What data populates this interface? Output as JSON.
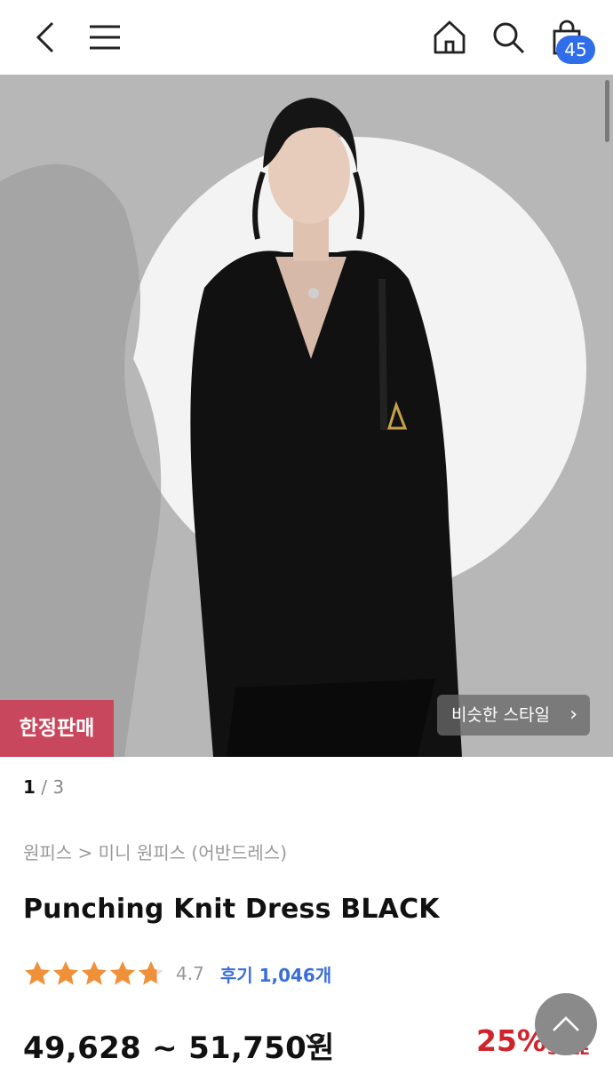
{
  "header": {
    "back_icon": "chevron-left-icon",
    "menu_icon": "hamburger-menu-icon",
    "home_icon": "home-icon",
    "search_icon": "search-icon",
    "cart_icon": "shopping-bag-icon",
    "cart_count": "45"
  },
  "hero": {
    "limited_label": "한정판매",
    "similar_style_label": "비슷한 스타일",
    "colors": {
      "badge": "#c9475c",
      "backdrop": "#b9b9b9"
    }
  },
  "gallery": {
    "current": "1",
    "separator": " / ",
    "total": "3"
  },
  "product": {
    "breadcrumb": "원피스 > 미니 원피스 (어반드레스)",
    "title": "Punching Knit Dress BLACK",
    "rating": 4.7,
    "rating_text": "4.7",
    "review_label": "후기 1,046개",
    "price_range": "49,628 ~ 51,750원",
    "discount": "25%",
    "sale_label": "SALE"
  },
  "colors": {
    "accent": "#2f6ee8",
    "discount": "#d0242c",
    "star": "#f0913a"
  }
}
